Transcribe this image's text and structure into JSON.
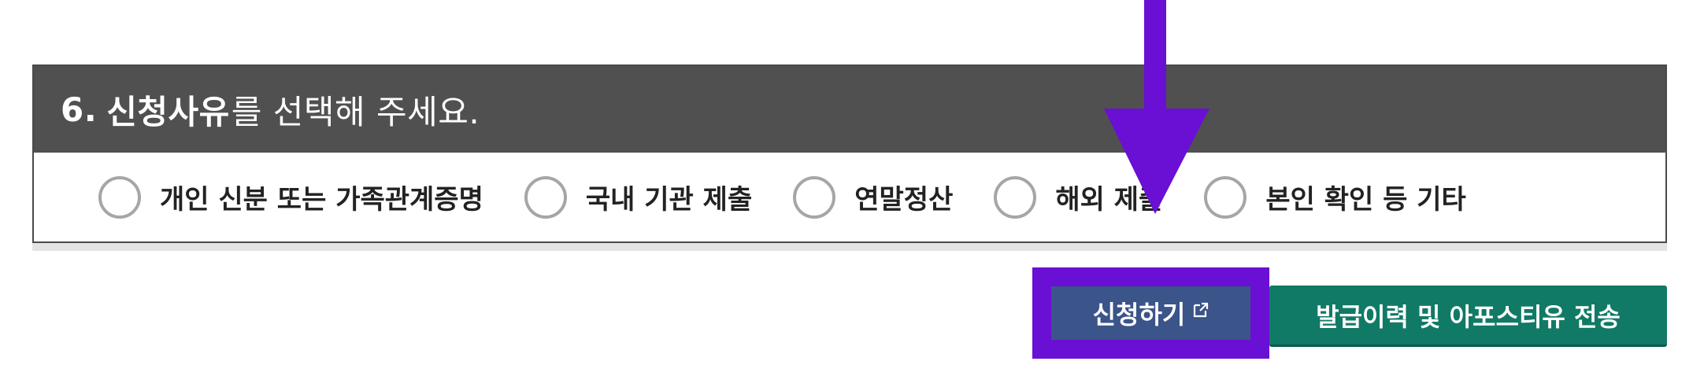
{
  "section": {
    "number": "6.",
    "keyword": "신청사유",
    "rest": "를 선택해 주세요."
  },
  "options": [
    {
      "label": "개인 신분 또는 가족관계증명"
    },
    {
      "label": "국내 기관 제출"
    },
    {
      "label": "연말정산"
    },
    {
      "label": "해외 제출"
    },
    {
      "label": "본인 확인 등 기타"
    }
  ],
  "buttons": {
    "apply_label": "신청하기",
    "history_label": "발급이력 및 아포스티유 전송"
  },
  "colors": {
    "header_bg": "#505050",
    "apply_bg": "#3b5489",
    "history_bg": "#117a66",
    "annotation": "#6a0fd4"
  }
}
